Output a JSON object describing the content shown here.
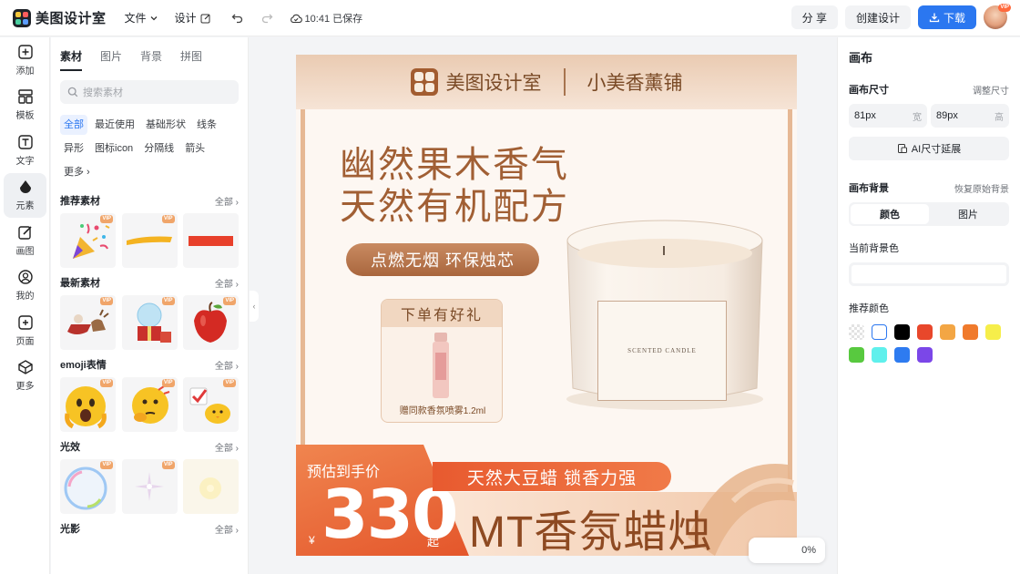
{
  "app": {
    "name": "美图设计室"
  },
  "menu": {
    "file": "文件",
    "design": "设计",
    "save_status": "10:41 已保存"
  },
  "actions": {
    "share": "分 享",
    "create": "创建设计",
    "download": "下载",
    "avatar_badge": "VIP"
  },
  "rail": [
    {
      "label": "添加",
      "icon": "plus-square-icon"
    },
    {
      "label": "模板",
      "icon": "template-icon"
    },
    {
      "label": "文字",
      "icon": "text-icon"
    },
    {
      "label": "元素",
      "icon": "shapes-icon"
    },
    {
      "label": "画图",
      "icon": "draw-icon"
    },
    {
      "label": "我的",
      "icon": "user-icon"
    },
    {
      "label": "页面",
      "icon": "page-icon"
    },
    {
      "label": "更多",
      "icon": "cube-icon"
    }
  ],
  "panel": {
    "tabs": [
      "素材",
      "图片",
      "背景",
      "拼图"
    ],
    "search_placeholder": "搜索素材",
    "chips": [
      "全部",
      "最近使用",
      "基础形状",
      "线条",
      "异形",
      "图标icon",
      "分隔线",
      "箭头",
      "更多"
    ],
    "sections": [
      {
        "title": "推荐素材",
        "all": "全部",
        "vip": [
          "VIP",
          "VIP",
          ""
        ]
      },
      {
        "title": "最新素材",
        "all": "全部",
        "vip": [
          "VIP",
          "VIP",
          "VIP"
        ]
      },
      {
        "title": "emoji表情",
        "all": "全部",
        "vip": [
          "VIP",
          "VIP",
          "VIP"
        ]
      },
      {
        "title": "光效",
        "all": "全部",
        "vip": [
          "VIP",
          "VIP",
          ""
        ]
      },
      {
        "title": "光影",
        "all": "全部",
        "vip": []
      }
    ]
  },
  "poster": {
    "brand": "美图设计室",
    "shop": "小美香薰铺",
    "headline1": "幽然果木香气",
    "headline2": "天然有机配方",
    "pill": "点燃无烟 环保烛芯",
    "gift_title": "下单有好礼",
    "gift_note": "赠同款香氛喷雾1.2ml",
    "candle_label": "SCENTED CANDLE",
    "price_label": "预估到手价",
    "price_currency": "¥",
    "price_value": "330",
    "price_suffix": "起",
    "slogan": "天然大豆蜡 锁香力强",
    "product_title": "MT香氛蜡烛"
  },
  "zoom": {
    "value": "0%"
  },
  "right": {
    "title": "画布",
    "size_label": "画布尺寸",
    "size_link": "调整尺寸",
    "width_value": "81px",
    "width_unit": "宽",
    "height_value": "89px",
    "height_unit": "高",
    "ai_button": "AI尺寸延展",
    "bg_label": "画布背景",
    "bg_reset": "恢复原始背景",
    "seg_color": "颜色",
    "seg_image": "图片",
    "current_bg": "当前背景色",
    "recommended": "推荐颜色",
    "colors": [
      "transparent",
      "#ffffff",
      "#000000",
      "#e8472b",
      "#f3a644",
      "#f07a2c",
      "#f6ee4a",
      "#58c93f",
      "#5ff0ec",
      "#2e7bf0",
      "#7b47e8"
    ]
  }
}
